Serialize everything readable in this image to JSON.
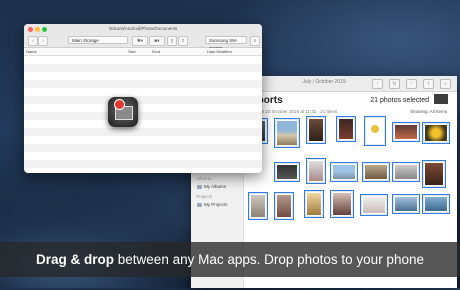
{
  "file_manager": {
    "path": "/sdcard/Android/Photo/Documents",
    "storage_select": "Main Storage",
    "device_select": "Samsung SM-G930F",
    "columns": {
      "name": "Name",
      "size": "Size",
      "kind": "Kind",
      "date": "Date Modified"
    },
    "rows": 15
  },
  "photos": {
    "window_title": "July / October 2019",
    "heading": "Imports",
    "subheading": "Taken on 23 October 2019 at 11:32",
    "subheading_count": "21 items",
    "selected_count": "21 photos selected",
    "showing": "Showing: All Items",
    "sidebar": {
      "section_albums": "Albums",
      "albums_item": "My Albums",
      "section_projects": "Projects",
      "projects_item": "My Projects"
    }
  },
  "caption": {
    "bold": "Drag & drop",
    "rest": " between any Mac apps. Drop photos to your phone"
  },
  "colors": {
    "close": "#ff5f57",
    "minimize": "#febc2e",
    "zoom": "#28c840",
    "selection": "#2b7de9"
  }
}
